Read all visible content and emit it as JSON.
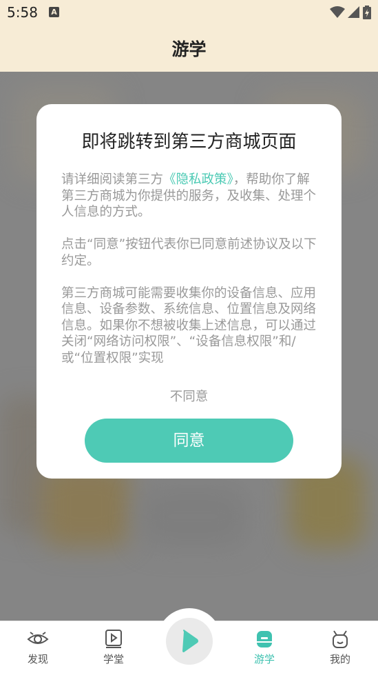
{
  "status_bar": {
    "time": "5:58",
    "notification_icon": "A"
  },
  "header": {
    "title": "游学"
  },
  "dialog": {
    "title": "即将跳转到第三方商城页面",
    "para1_before": "请详细阅读第三方",
    "para1_link": "《隐私政策》",
    "para1_after": "，帮助你了解第三方商城为你提供的服务，及收集、处理个人信息的方式。",
    "para2": "点击“同意”按钮代表你已同意前述协议及以下约定。",
    "para3": "第三方商城可能需要收集你的设备信息、应用信息、设备参数、系统信息、位置信息及网络信息。如果你不想被收集上述信息，可以通过关闭“网络访问权限”、“设备信息权限”和/或“位置权限”实现",
    "disagree_label": "不同意",
    "agree_label": "同意"
  },
  "bottom_nav": {
    "items": [
      {
        "label": "发现",
        "icon": "eye-icon"
      },
      {
        "label": "学堂",
        "icon": "video-book-icon"
      },
      {
        "label": "",
        "icon": "play-icon"
      },
      {
        "label": "游学",
        "icon": "backpack-icon",
        "active": true
      },
      {
        "label": "我的",
        "icon": "robot-icon"
      }
    ]
  },
  "colors": {
    "accent": "#4ecab5",
    "header_bg": "#f7ecd6",
    "overlay": "#858585"
  }
}
